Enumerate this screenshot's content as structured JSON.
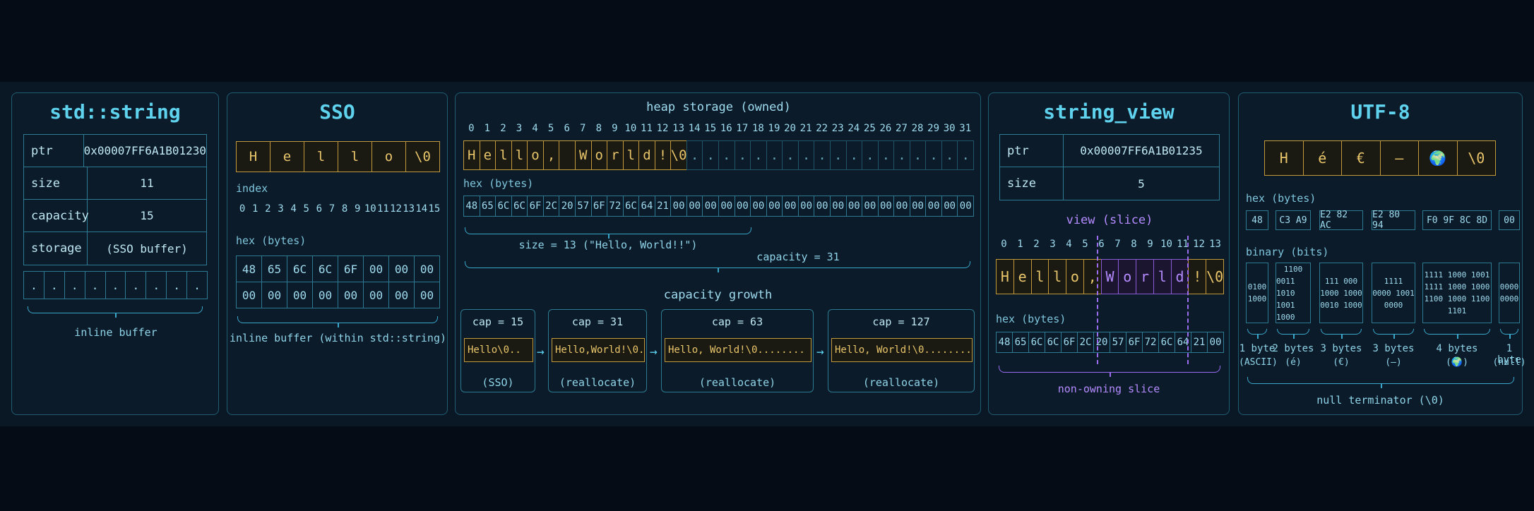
{
  "panels": {
    "stdstring": {
      "title": "std::string",
      "fields": [
        {
          "key": "ptr",
          "value": "0x00007FF6A1B01230"
        },
        {
          "key": "size",
          "value": "11"
        },
        {
          "key": "capacity",
          "value": "15"
        },
        {
          "key": "storage",
          "value": "(SSO buffer)"
        }
      ],
      "inline_cells": [
        ".",
        ".",
        ".",
        ".",
        ".",
        ".",
        ".",
        ".",
        "."
      ],
      "brace_label": "inline buffer"
    },
    "sso": {
      "title": "SSO",
      "chars": [
        "H",
        "e",
        "l",
        "l",
        "o",
        "\\0"
      ],
      "index_label": "index",
      "indices": [
        "0",
        "1",
        "2",
        "3",
        "4",
        "5",
        "6",
        "7",
        "8",
        "9",
        "10",
        "11",
        "12",
        "13",
        "14",
        "15"
      ],
      "hex_label": "hex (bytes)",
      "hex_row1": [
        "48",
        "65",
        "6C",
        "6C",
        "6F",
        "00",
        "00",
        "00"
      ],
      "hex_row2": [
        "00",
        "00",
        "00",
        "00",
        "00",
        "00",
        "00",
        "00"
      ],
      "brace_label": "inline buffer (within std::string)"
    },
    "heap": {
      "title": "heap storage (owned)",
      "indices": [
        "0",
        "1",
        "2",
        "3",
        "4",
        "5",
        "6",
        "7",
        "8",
        "9",
        "10",
        "11",
        "12",
        "13",
        "14",
        "15",
        "16",
        "17",
        "18",
        "19",
        "20",
        "21",
        "22",
        "23",
        "24",
        "25",
        "26",
        "27",
        "28",
        "29",
        "30",
        "31"
      ],
      "chars": [
        "H",
        "e",
        "l",
        "l",
        "o",
        ",",
        "",
        "W",
        "o",
        "r",
        "l",
        "d",
        "!",
        "\\0",
        ".",
        ".",
        ".",
        ".",
        ".",
        ".",
        ".",
        ".",
        ".",
        ".",
        ".",
        ".",
        ".",
        ".",
        ".",
        ".",
        ".",
        "."
      ],
      "hex_label": "hex (bytes)",
      "hex": [
        "48",
        "65",
        "6C",
        "6C",
        "6F",
        "2C",
        "20",
        "57",
        "6F",
        "72",
        "6C",
        "64",
        "21",
        "00",
        "00",
        "00",
        "00",
        "00",
        "00",
        "00",
        "00",
        "00",
        "00",
        "00",
        "00",
        "00",
        "00",
        "00",
        "00",
        "00",
        "00",
        "00"
      ],
      "size_label": "size = 13 (\"Hello, World!!\")",
      "capacity_label": "capacity = 31",
      "growth_title": "capacity growth",
      "growth": [
        {
          "cap": "cap = 15",
          "buf": "Hello\\0..",
          "note": "(SSO)"
        },
        {
          "cap": "cap = 31",
          "buf": "Hello,World!\\0..",
          "note": "(reallocate)"
        },
        {
          "cap": "cap = 63",
          "buf": "Hello, World!\\0........",
          "note": "(reallocate)"
        },
        {
          "cap": "cap = 127",
          "buf": "Hello, World!\\0........",
          "note": "(reallocate)"
        }
      ],
      "arrow": "→"
    },
    "view": {
      "title": "string_view",
      "fields": [
        {
          "key": "ptr",
          "value": "0x00007FF6A1B01235"
        },
        {
          "key": "size",
          "value": "5"
        }
      ],
      "slice_label": "view (slice)",
      "indices": [
        "0",
        "1",
        "2",
        "3",
        "4",
        "5",
        "6",
        "7",
        "8",
        "9",
        "10",
        "11",
        "12",
        "13"
      ],
      "chars": [
        "H",
        "e",
        "l",
        "l",
        "o",
        ",",
        "W",
        "o",
        "r",
        "l",
        "d",
        "!",
        "\\0"
      ],
      "hex_label": "hex (bytes)",
      "hex": [
        "48",
        "65",
        "6C",
        "6C",
        "6F",
        "2C",
        "20",
        "57",
        "6F",
        "72",
        "6C",
        "64",
        "21",
        "00"
      ],
      "brace_label": "non-owning slice"
    },
    "utf8": {
      "title": "UTF-8",
      "chars": [
        "H",
        "é",
        "€",
        "—",
        "🌍",
        "\\0"
      ],
      "hex_label": "hex (bytes)",
      "hex_groups": [
        "48",
        "C3 A9",
        "E2 82 AC",
        "E2 80 94",
        "F0 9F 8C 8D",
        "00"
      ],
      "binary_label": "binary (bits)",
      "binary_groups": [
        [
          "0100",
          "1000"
        ],
        [
          "1100",
          "0011 1010",
          "1001 1000"
        ],
        [
          "111 000",
          "1000 1000",
          "0010 1000"
        ],
        [
          "1111",
          "0000 1001",
          "0000"
        ],
        [
          "1111 1000 1001",
          "1111 1000 1000",
          "1100 1000 1100",
          "1101"
        ],
        [
          "0000",
          "0000"
        ]
      ],
      "byte_counts": [
        {
          "n": "1 byte",
          "c": "(ASCII)"
        },
        {
          "n": "2 bytes",
          "c": "(é)"
        },
        {
          "n": "3 bytes",
          "c": "(€)"
        },
        {
          "n": "3 bytes",
          "c": "(–)"
        },
        {
          "n": "4 bytes",
          "c": "(🌍)"
        },
        {
          "n": "1 byte",
          "c": "(null)"
        }
      ],
      "brace_label": "null terminator (\\0)"
    }
  }
}
